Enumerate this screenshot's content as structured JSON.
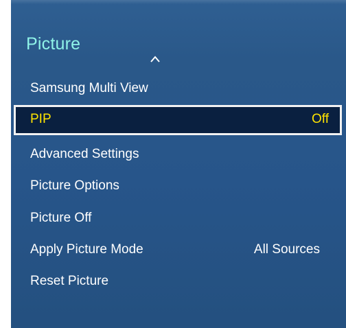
{
  "menu": {
    "title": "Picture",
    "scroll_indicator_icon": "chevron-up-icon",
    "items": [
      {
        "label": "Samsung Multi View",
        "value": ""
      },
      {
        "label": "PIP",
        "value": "Off",
        "selected": true
      },
      {
        "label": "Advanced Settings",
        "value": ""
      },
      {
        "label": "Picture Options",
        "value": ""
      },
      {
        "label": "Picture Off",
        "value": ""
      },
      {
        "label": "Apply Picture Mode",
        "value": "All Sources"
      },
      {
        "label": "Reset Picture",
        "value": ""
      }
    ]
  },
  "colors": {
    "title": "#8ff3e8",
    "panel": "#2a5889",
    "selected_bg": "#0a2040",
    "selected_text": "#ffe400",
    "text": "#ffffff"
  }
}
